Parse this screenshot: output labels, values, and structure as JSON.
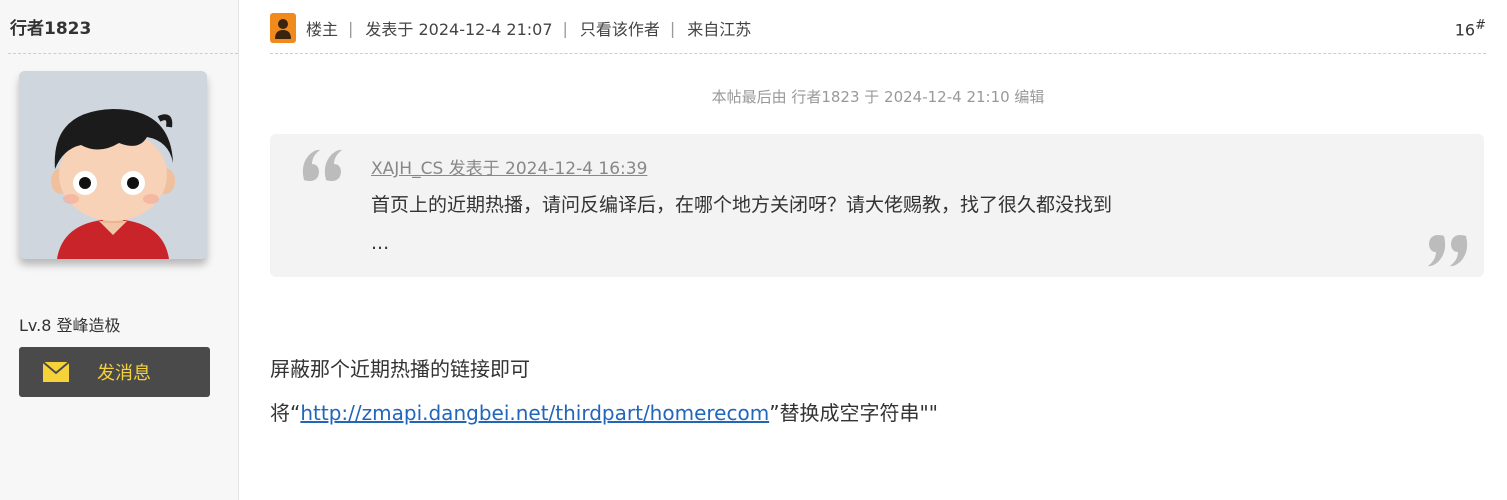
{
  "author": {
    "name": "行者1823",
    "level": "Lv.8 登峰造极",
    "message_button": "发消息"
  },
  "post_meta": {
    "op_label": "楼主",
    "posted": "发表于 2024-12-4 21:07",
    "only_author": "只看该作者",
    "location": "来自江苏",
    "floor_number": "16",
    "floor_suffix": "#"
  },
  "edit_note": "本帖最后由 行者1823 于 2024-12-4 21:10 编辑",
  "quote": {
    "cite": "XAJH_CS 发表于 2024-12-4 16:39",
    "text": "首页上的近期热播，请问反编译后，在哪个地方关闭呀？请大佬赐教，找了很久都没找到",
    "ellipsis": "..."
  },
  "body": {
    "line1": "屏蔽那个近期热播的链接即可",
    "line2_prefix": "将“",
    "link": "http://zmapi.dangbei.net/thirdpart/homerecom",
    "line2_suffix": "”替换成空字符串\"\""
  },
  "colors": {
    "accent_yellow": "#f5d23a",
    "button_bg": "#4a4a4a",
    "link": "#2266bb",
    "op_badge": "#f08a1c"
  }
}
